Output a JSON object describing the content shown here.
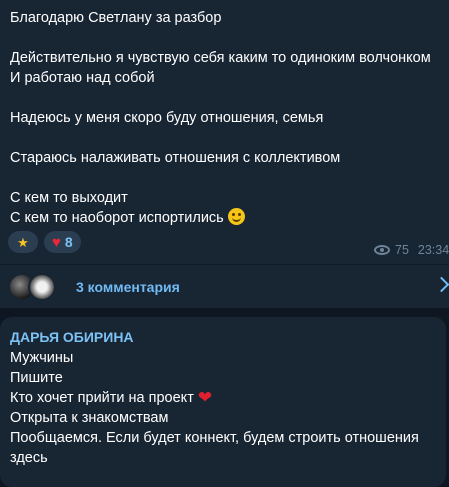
{
  "post": {
    "lines": [
      "Благодарю Светлану за разбор",
      "",
      "Действительно я чувствую себя каким то одиноким волчонком",
      "И работаю над собой",
      "",
      "Надеюсь у меня скоро буду отношения, семья",
      "",
      "Стараюсь налаживать отношения с коллективом",
      "",
      "С кем то выходит",
      "С кем то наоборот испортились"
    ],
    "trailing_emoji": "smiling-face-icon",
    "reactions": [
      {
        "icon": "star-icon",
        "count": ""
      },
      {
        "icon": "heart-icon",
        "count": "8"
      }
    ],
    "views": "75",
    "time": "23:34"
  },
  "comments_bar": {
    "label": "3 комментария",
    "avatars": [
      "avatar-1",
      "avatar-2"
    ]
  },
  "comment": {
    "author": "ДАРЬЯ ОБИРИНА",
    "lines": [
      "Мужчины",
      "Пишите",
      "Кто хочет прийти на проект",
      "Открыта к знакомствам",
      "Пообщаемся. Если будет коннект, будем строить отношения",
      "здесь"
    ],
    "heart_after_line": 2
  },
  "colors": {
    "background": "#0e1621",
    "bubble": "#182533",
    "accent": "#71baf3",
    "heart": "#e8283a",
    "meta": "#6e8499"
  }
}
